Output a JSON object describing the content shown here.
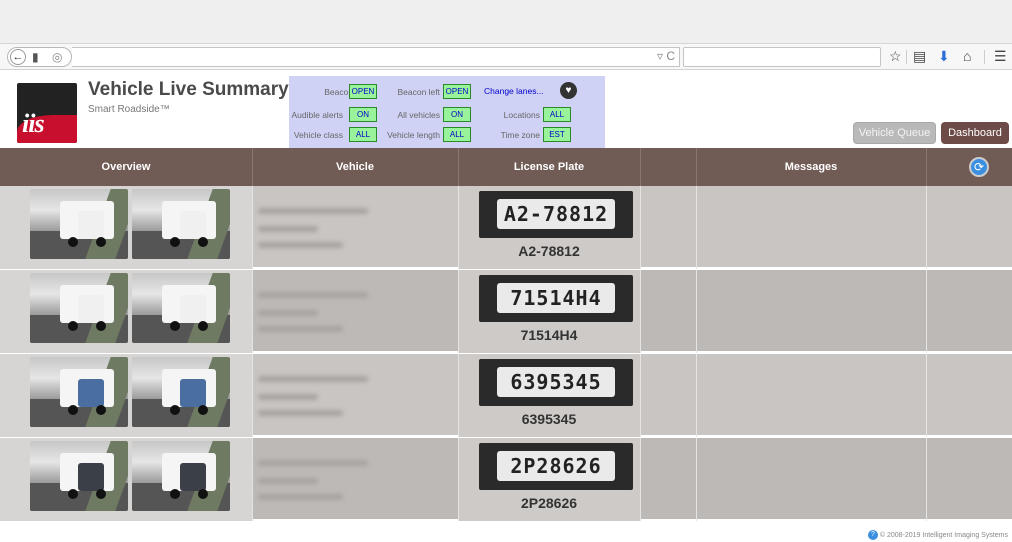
{
  "browser": {
    "back_icon": "back-arrow-icon",
    "url_dropdown_glyph": "▿",
    "reload_glyph": "C",
    "icons": [
      "star-icon",
      "reading-list-icon",
      "download-icon",
      "home-icon",
      "menu-icon"
    ]
  },
  "header": {
    "logo_text": "iis",
    "title": "Vehicle Live Summary",
    "subtitle": "Smart Roadside™"
  },
  "status": {
    "beacon_right": {
      "label": "Beacon right",
      "value": "OPEN"
    },
    "beacon_left": {
      "label": "Beacon left",
      "value": "OPEN"
    },
    "change_lanes": "Change lanes...",
    "audible_alerts": {
      "label": "Audible alerts",
      "value": "ON"
    },
    "all_vehicles": {
      "label": "All vehicles",
      "value": "ON"
    },
    "locations": {
      "label": "Locations",
      "value": "ALL"
    },
    "vehicle_class": {
      "label": "Vehicle class",
      "value": "ALL"
    },
    "vehicle_length": {
      "label": "Vehicle length",
      "value": "ALL"
    },
    "time_zone": {
      "label": "Time zone",
      "value": "EST"
    }
  },
  "buttons": {
    "vehicle_queue": "Vehicle Queue",
    "dashboard": "Dashboard"
  },
  "table": {
    "headers": [
      "Overview",
      "Vehicle",
      "License Plate",
      "",
      "Messages",
      ""
    ],
    "rows": [
      {
        "plate_image_text": "A2-78812",
        "plate": "A2-78812",
        "cab_color": "#f0f0f0"
      },
      {
        "plate_image_text": "71514H4",
        "plate": "71514H4",
        "cab_color": "#f0f0f0"
      },
      {
        "plate_image_text": "6395345",
        "plate": "6395345",
        "cab_color": "#4a6ea0"
      },
      {
        "plate_image_text": "2P28626",
        "plate": "2P28626",
        "cab_color": "#3a3f48"
      }
    ]
  },
  "footer": {
    "copyright": "© 2008-2019 Intelligent Imaging Systems"
  },
  "colors": {
    "header_bar": "#715b55",
    "status_panel": "#cfd2f5",
    "status_value_bg": "#99f39a",
    "dashboard_button": "#6d4b46",
    "logo_red": "#c8102e"
  }
}
